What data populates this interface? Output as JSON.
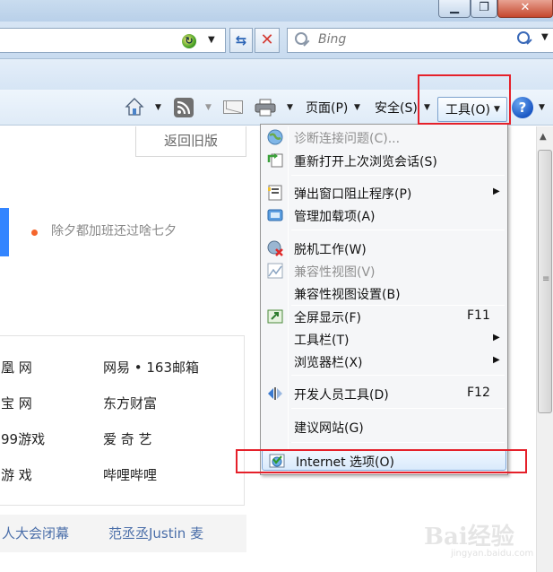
{
  "search": {
    "placeholder": "Bing"
  },
  "commandbar": {
    "page_label": "页面(P)",
    "safety_label": "安全(S)",
    "tools_label": "工具(O)"
  },
  "page": {
    "back_old": "返回旧版",
    "news": "除夕都加班还过啥七夕",
    "sites": [
      "凰 网",
      "网易 • 163邮箱",
      "宝 网",
      "东方财富",
      "99游戏",
      "爱 奇 艺",
      "游 戏",
      "哔哩哔哩"
    ],
    "hot": [
      "人大会闭幕",
      "范丞丞Justin 麦"
    ]
  },
  "menu": {
    "items": [
      {
        "label": "诊断连接问题(C)...",
        "disabled": true
      },
      {
        "label": "重新打开上次浏览会话(S)"
      },
      {
        "label": "弹出窗口阻止程序(P)",
        "submenu": true
      },
      {
        "label": "管理加载项(A)"
      },
      {
        "label": "脱机工作(W)"
      },
      {
        "label": "兼容性视图(V)",
        "disabled": true
      },
      {
        "label": "兼容性视图设置(B)"
      },
      {
        "label": "全屏显示(F)",
        "shortcut": "F11"
      },
      {
        "label": "工具栏(T)",
        "submenu": true
      },
      {
        "label": "浏览器栏(X)",
        "submenu": true
      },
      {
        "label": "开发人员工具(D)",
        "shortcut": "F12"
      },
      {
        "label": "建议网站(G)"
      },
      {
        "label": "Internet 选项(O)",
        "highlighted": true
      }
    ]
  },
  "watermark": {
    "logo": "Bai经验",
    "url": "jingyan.baidu.com"
  },
  "colors": {
    "annotation": "#e5202a",
    "accent": "#3385ff",
    "menu_bg": "#f5f6f8"
  }
}
